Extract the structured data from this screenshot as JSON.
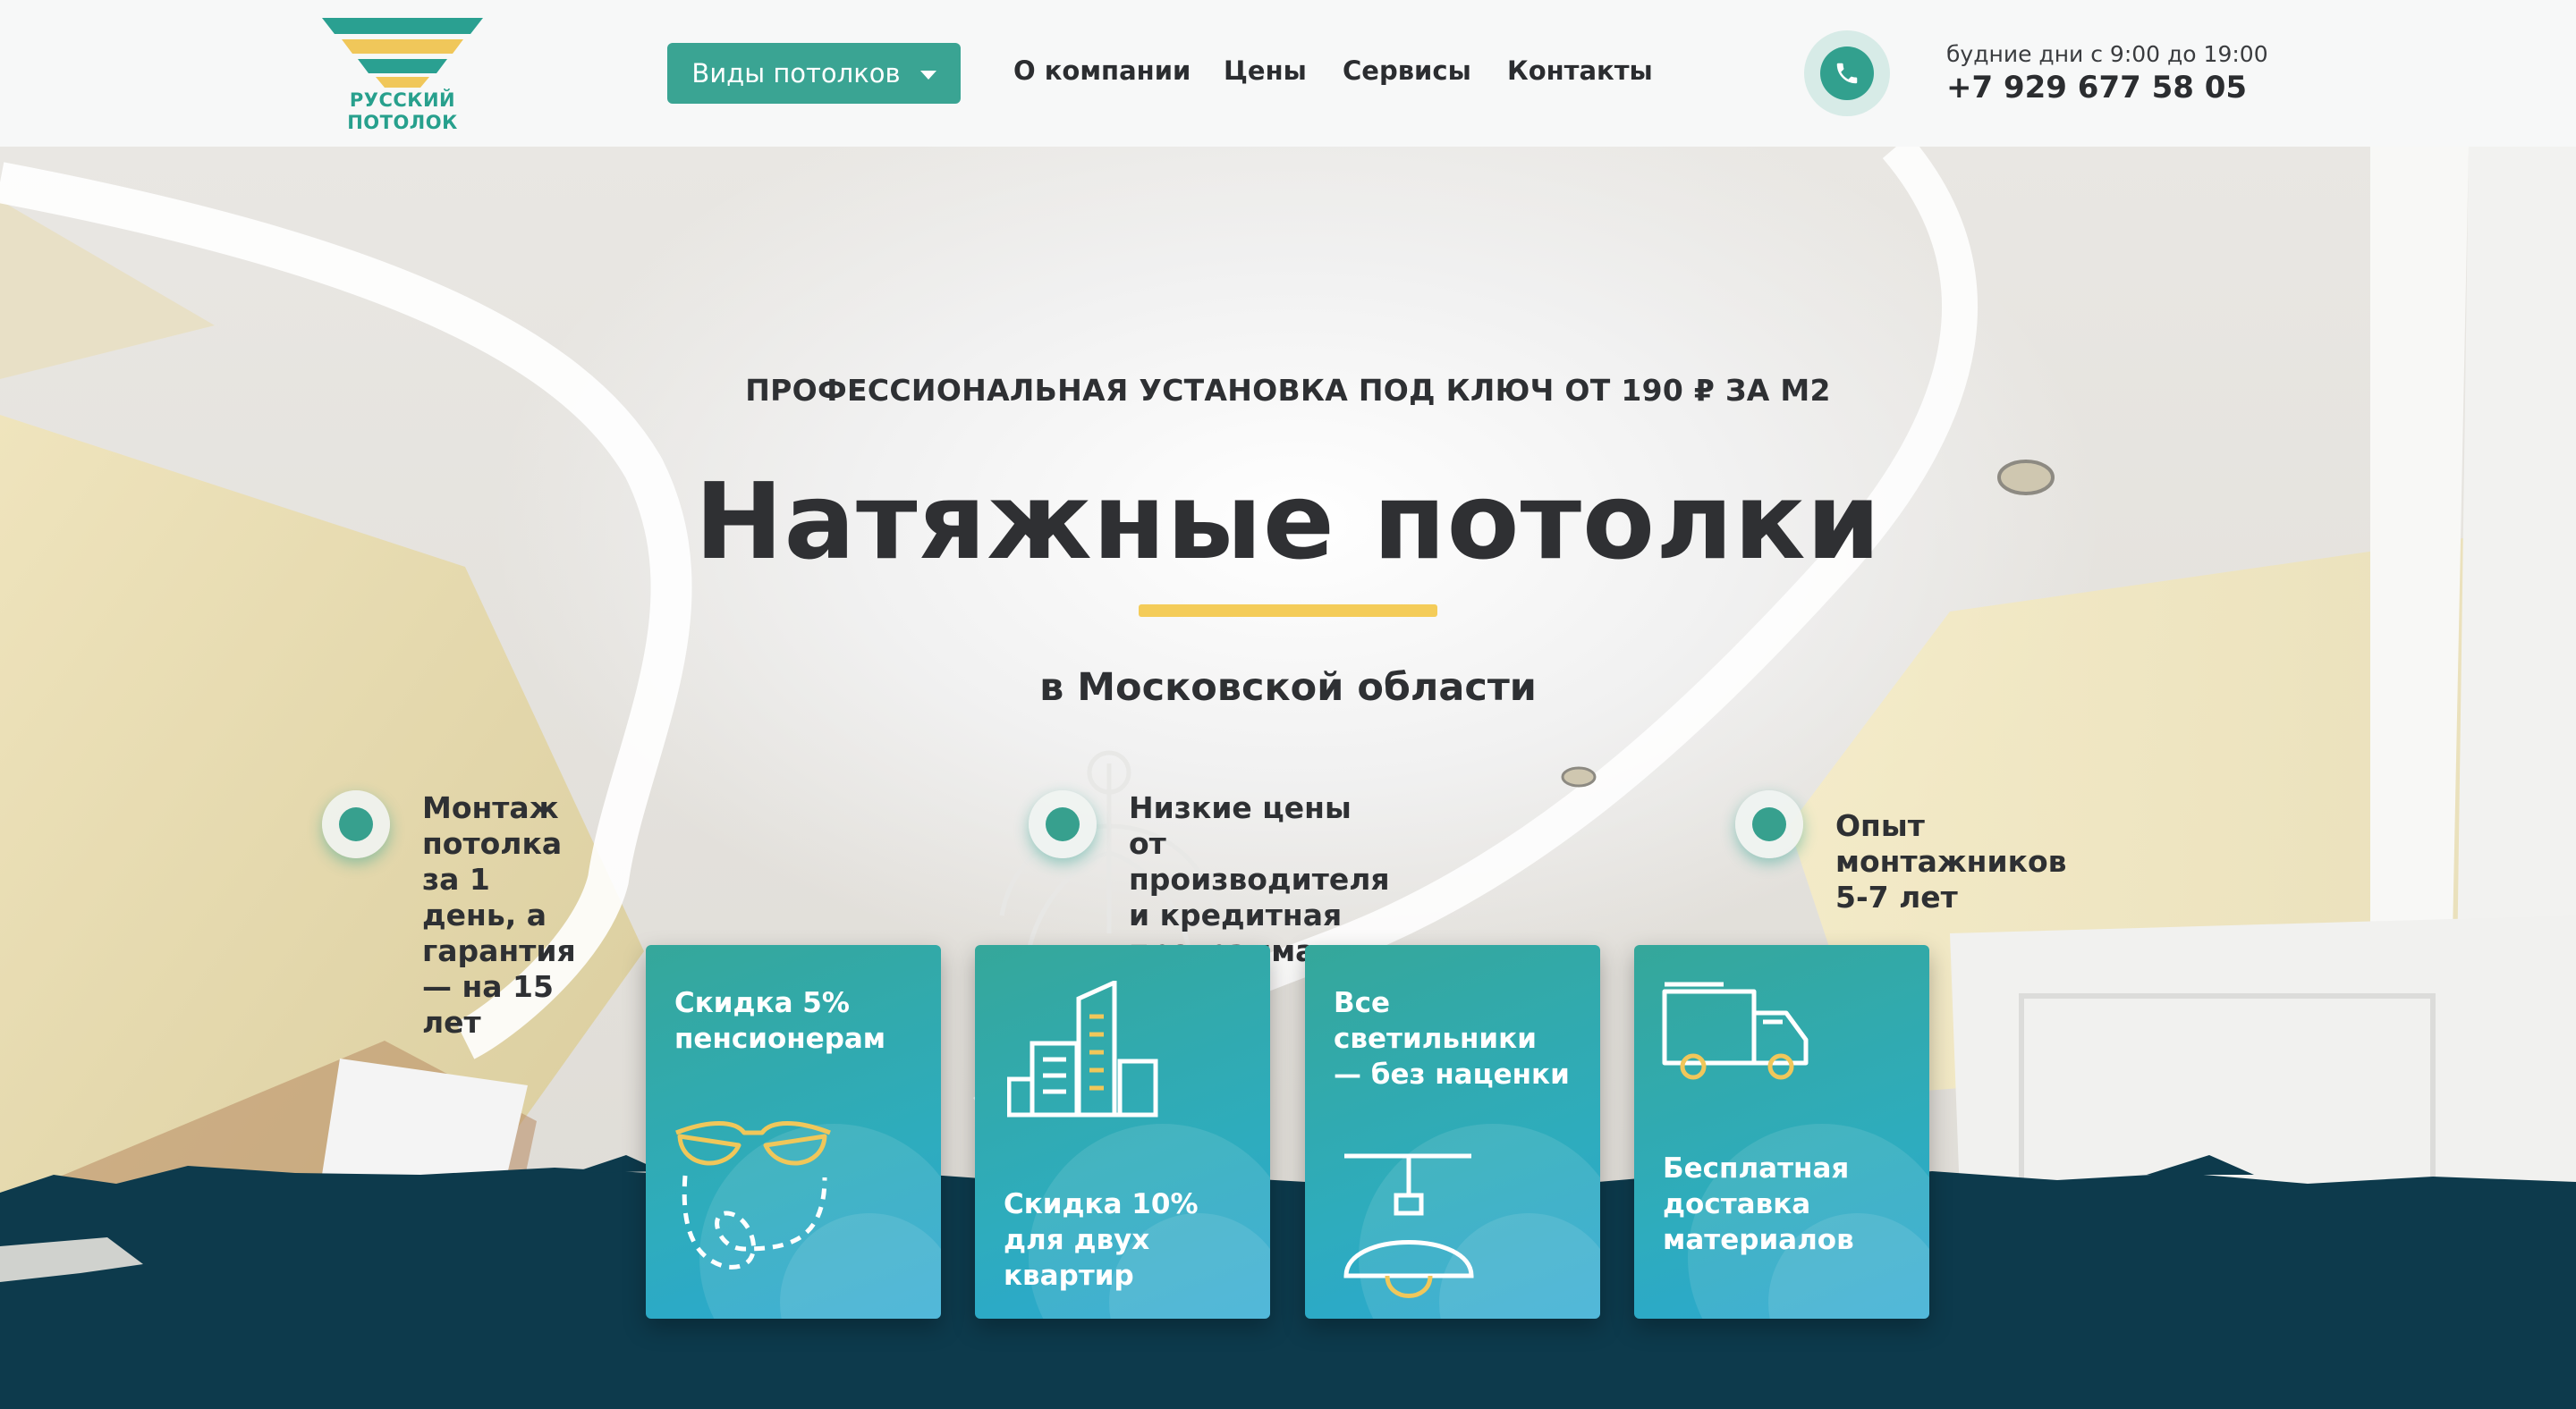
{
  "header": {
    "logo_line1": "РУССКИЙ",
    "logo_line2": "ПОТОЛОК",
    "dropdown_label": "Виды потолков",
    "nav": [
      "О компании",
      "Цены",
      "Сервисы",
      "Контакты"
    ],
    "hours": "будние дни с 9:00 до 19:00",
    "phone": "+7 929 677 58 05",
    "phone_icon": "phone-icon"
  },
  "hero": {
    "eyebrow": "ПРОФЕССИОНАЛЬНАЯ УСТАНОВКА ПОД КЛЮЧ ОТ 190 ₽ ЗА М2",
    "title": "Натяжные потолки",
    "subtitle": "в Московской области",
    "features": [
      {
        "line1": "Монтаж потолка за 1 день, а",
        "line2": "гарантия — на 15 лет"
      },
      {
        "line1": "Низкие цены от производителя",
        "line2": "и кредитная программа"
      },
      {
        "line1": "Опыт монтажников 5-7 лет",
        "line2": ""
      }
    ]
  },
  "cards": [
    {
      "line1": "Скидка 5%",
      "line2": "пенсионерам",
      "line3": "",
      "icon": "glasses-icon"
    },
    {
      "line1": "Скидка 10%",
      "line2": "для двух",
      "line3": "квартир",
      "icon": "buildings-icon"
    },
    {
      "line1": "Все",
      "line2": "светильники",
      "line3": "— без наценки",
      "icon": "lamp-icon"
    },
    {
      "line1": "Бесплатная",
      "line2": "доставка",
      "line3": "материалов",
      "icon": "truck-icon"
    }
  ],
  "colors": {
    "accent": "#3aa493",
    "yellow": "#f4cc59",
    "dark_band": "#0d3a4c",
    "card_from": "#35a79a",
    "card_to": "#2aa7d2"
  }
}
